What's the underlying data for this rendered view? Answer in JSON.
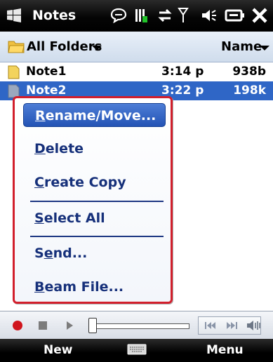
{
  "app": {
    "title": "Notes"
  },
  "folderbar": {
    "folder_label": "All Folders",
    "sort_label": "Name"
  },
  "files": [
    {
      "name": "Note1",
      "time": "3:14 p",
      "size": "938b"
    },
    {
      "name": "Note2",
      "time": "3:22 p",
      "size": "198k"
    }
  ],
  "context_menu": {
    "items": [
      {
        "label": "Rename/Move...",
        "accel": "R",
        "rest": "ename/Move..."
      },
      {
        "label": "Delete",
        "accel": "D",
        "rest": "elete"
      },
      {
        "label": "Create Copy",
        "accel": "C",
        "rest": "reate Copy"
      },
      {
        "label": "Select All",
        "accel": "S",
        "rest": "elect All"
      },
      {
        "label": "Send...",
        "pre": "S",
        "accel": "e",
        "rest": "nd..."
      },
      {
        "label": "Beam File...",
        "accel": "B",
        "rest": "eam File..."
      }
    ]
  },
  "softkeys": {
    "left": "New",
    "right": "Menu"
  },
  "colors": {
    "selection": "#2f66c6",
    "menu_border": "#d21f2c",
    "menu_text": "#16307a"
  },
  "icons": [
    "windows-start-icon",
    "chat-icon",
    "battery-icon",
    "sync-icon",
    "signal-icon",
    "speaker-icon",
    "connection-icon",
    "close-icon",
    "folder-icon",
    "note-icon",
    "record-icon",
    "stop-icon",
    "play-icon",
    "rewind-icon",
    "fast-forward-icon",
    "volume-icon",
    "keyboard-icon"
  ]
}
